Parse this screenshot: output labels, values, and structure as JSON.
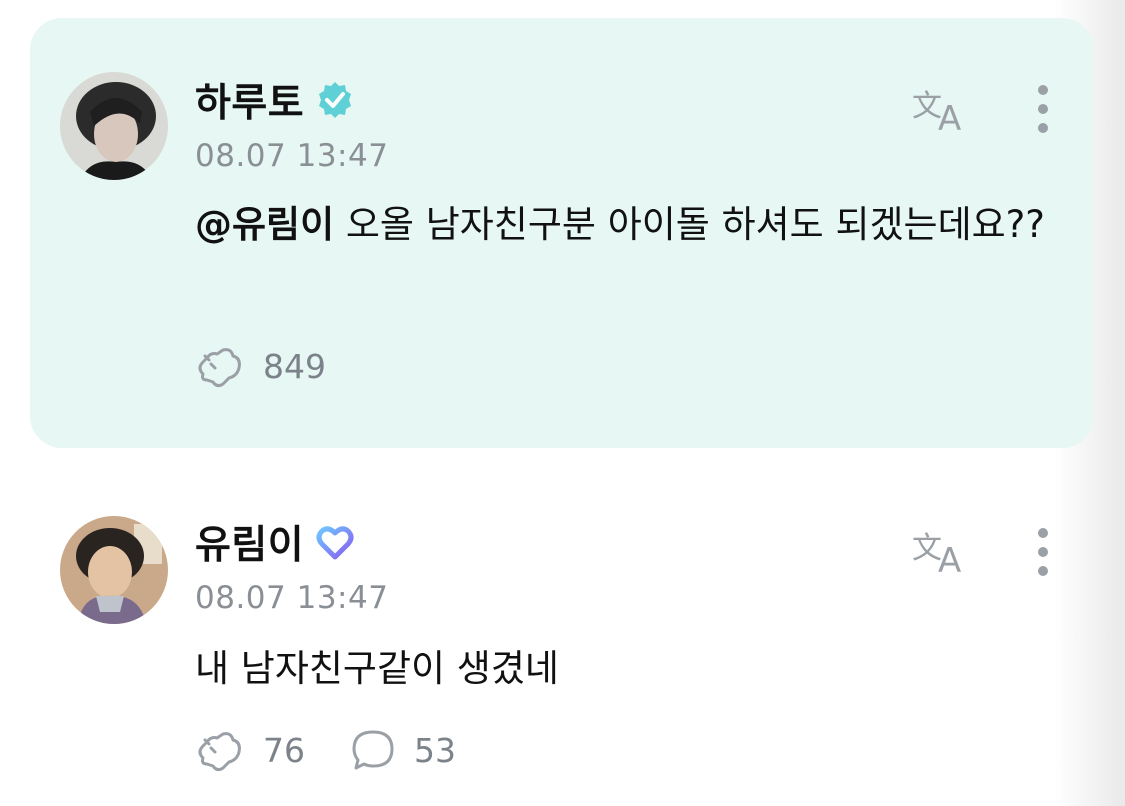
{
  "post": {
    "author": "하루토",
    "badge_icon": "verified-check-icon",
    "badge_color": "#5fd0d6",
    "timestamp": "08.07 13:47",
    "mention": "@유림이",
    "text": " 오올 남자친구분 아이돌 하셔도 되겠는데요??",
    "like_count": "849",
    "background": "#e6f7f4"
  },
  "reply": {
    "author": "유림이",
    "badge_icon": "heart-badge-icon",
    "badge_color": "#7b7ff2",
    "timestamp": "08.07 13:47",
    "text": "내 남자친구같이 생겼네",
    "like_count": "76",
    "comment_count": "53"
  },
  "icons": {
    "translate": "translate-icon",
    "more": "more-vertical-icon",
    "like": "cheer-icon",
    "comment": "comment-bubble-icon"
  },
  "colors": {
    "icon_gray": "#9aa0a6",
    "timestamp_gray": "#8a8f96"
  }
}
